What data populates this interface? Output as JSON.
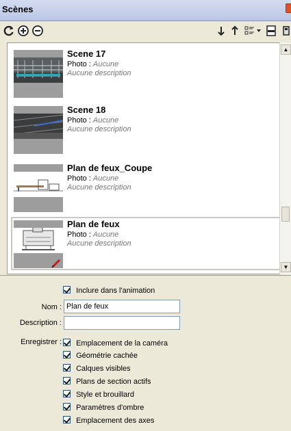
{
  "window": {
    "title": "Scènes"
  },
  "toolbar": {
    "buttons": [
      {
        "name": "refresh-icon"
      },
      {
        "name": "add-scene-icon"
      },
      {
        "name": "remove-scene-icon"
      },
      {
        "name": "move-down-icon"
      },
      {
        "name": "move-up-icon"
      },
      {
        "name": "view-options-icon"
      },
      {
        "name": "toggle-details-icon"
      }
    ]
  },
  "scenes": [
    {
      "title": "Scene 17",
      "photo_label": "Photo : ",
      "photo_value": "Aucune",
      "description": "Aucune description",
      "selected": false
    },
    {
      "title": "Scene 18",
      "photo_label": "Photo : ",
      "photo_value": "Aucune",
      "description": "Aucune description",
      "selected": false
    },
    {
      "title": "Plan de feux_Coupe",
      "photo_label": "Photo : ",
      "photo_value": "Aucune",
      "description": "Aucune description",
      "selected": false
    },
    {
      "title": "Plan de feux",
      "photo_label": "Photo : ",
      "photo_value": "Aucune",
      "description": "Aucune description",
      "selected": true
    }
  ],
  "properties": {
    "include_animation": {
      "label": "Inclure dans l'animation",
      "checked": true
    },
    "name_label": "Nom :",
    "name_value": "Plan de feux",
    "description_label": "Description :",
    "description_value": "",
    "save_label": "Enregistrer :",
    "save_options": [
      {
        "label": "Emplacement de la caméra",
        "checked": true
      },
      {
        "label": "Géométrie cachée",
        "checked": true
      },
      {
        "label": "Calques visibles",
        "checked": true
      },
      {
        "label": "Plans de section actifs",
        "checked": true
      },
      {
        "label": "Style et brouillard",
        "checked": true
      },
      {
        "label": "Paramètres d'ombre",
        "checked": true
      },
      {
        "label": "Emplacement des axes",
        "checked": true
      }
    ]
  }
}
